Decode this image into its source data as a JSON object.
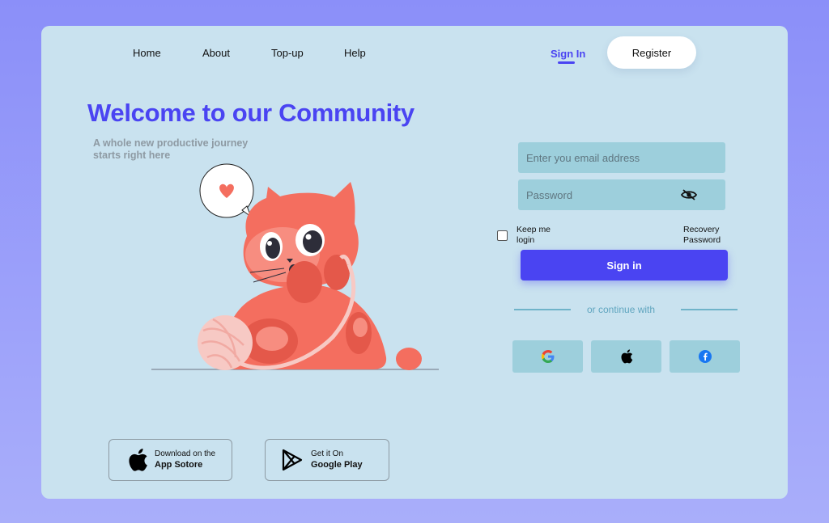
{
  "nav": {
    "home": "Home",
    "about": "About",
    "topup": "Top-up",
    "help": "Help",
    "signin": "Sign In",
    "register": "Register"
  },
  "hero": {
    "title": "Welcome to our Community",
    "subtitle": "A whole new productive journey starts right here"
  },
  "form": {
    "email_placeholder": "Enter you email address",
    "password_placeholder": "Password",
    "keep_login": "Keep me login",
    "recovery": "Recovery Password",
    "signin_button": "Sign in",
    "continue_with": "or continue with"
  },
  "social": {
    "google_icon": "google-icon",
    "apple_icon": "apple-icon",
    "facebook_icon": "facebook-icon"
  },
  "stores": {
    "appstore_line1": "Download on the",
    "appstore_line2": "App Sotore",
    "googleplay_line1": "Get it On",
    "googleplay_line2": "Google Play"
  },
  "colors": {
    "accent": "#4a44f2",
    "card": "#c9e2ef",
    "field": "#9dcfdc",
    "cat": "#f46e5f"
  }
}
